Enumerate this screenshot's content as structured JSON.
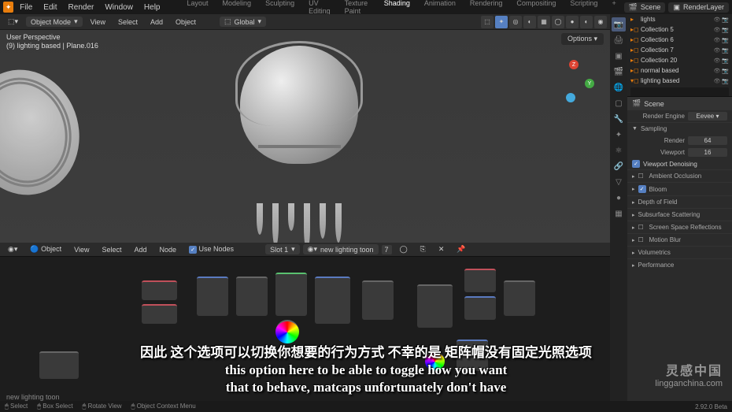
{
  "topbar": {
    "menus": [
      "File",
      "Edit",
      "Render",
      "Window",
      "Help"
    ],
    "tabs": [
      "Layout",
      "Modeling",
      "Sculpting",
      "UV Editing",
      "Texture Paint",
      "Shading",
      "Animation",
      "Rendering",
      "Compositing",
      "Scripting"
    ],
    "active_tab": "Shading",
    "scene_label": "Scene",
    "layer_label": "RenderLayer"
  },
  "viewport": {
    "mode": "Object Mode",
    "menus": [
      "View",
      "Select",
      "Add",
      "Object"
    ],
    "orientation": "Global",
    "info_line1": "User Perspective",
    "info_line2": "(9) lighting based | Plane.016",
    "options_label": "Options"
  },
  "node_editor": {
    "mode": "Object",
    "menus": [
      "View",
      "Select",
      "Add",
      "Node"
    ],
    "use_nodes": "Use Nodes",
    "slot": "Slot 1",
    "material": "new lighting toon",
    "users": "7",
    "footer_label": "new lighting toon"
  },
  "outliner": {
    "header": "lights",
    "items": [
      {
        "name": "Collection 5"
      },
      {
        "name": "Collection 6"
      },
      {
        "name": "Collection 7"
      },
      {
        "name": "Collection 20"
      },
      {
        "name": "normal based"
      },
      {
        "name": "lighting based"
      }
    ],
    "search_placeholder": ""
  },
  "properties": {
    "scene_label": "Scene",
    "engine_label": "Render Engine",
    "engine_value": "Eevee",
    "sampling_header": "Sampling",
    "render_label": "Render",
    "render_value": "64",
    "viewport_label": "Viewport",
    "viewport_value": "16",
    "denoise_label": "Viewport Denoising",
    "sections": [
      "Ambient Occlusion",
      "Bloom",
      "Depth of Field",
      "Subsurface Scattering",
      "Screen Space Reflections",
      "Motion Blur",
      "Volumetrics",
      "Performance"
    ],
    "checked_sections": [
      "Bloom"
    ]
  },
  "statusbar": {
    "items": [
      "Select",
      "Box Select",
      "Rotate View",
      "Object Context Menu"
    ],
    "version": "2.92.0 Beta"
  },
  "subtitle": {
    "cn": "因此 这个选项可以切换你想要的行为方式 不幸的是 矩阵帽没有固定光照选项",
    "en1": "this option here to be able to toggle how you want",
    "en2": "that to behave, matcaps unfortunately don't have"
  },
  "watermark": {
    "brand": "灵感中国",
    "url": "lingganchina.com"
  }
}
